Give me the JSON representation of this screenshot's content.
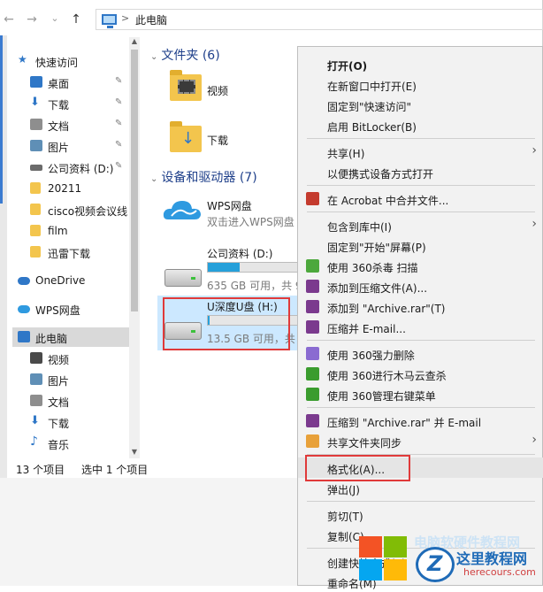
{
  "address_bar": {
    "back": "←",
    "forward": "→",
    "recent": "⌄",
    "up": "↑",
    "separator": ">",
    "path": "此电脑"
  },
  "nav": {
    "items": [
      {
        "label": "快速访问",
        "icon": "star-icon",
        "color": "#2f77c7",
        "pinned": false
      },
      {
        "label": "桌面",
        "icon": "desktop-icon",
        "color": "#2f77c7",
        "pinned": true
      },
      {
        "label": "下载",
        "icon": "download-icon",
        "color": "#2f77c7",
        "pinned": true
      },
      {
        "label": "文档",
        "icon": "document-icon",
        "color": "#8e8e8e",
        "pinned": true
      },
      {
        "label": "图片",
        "icon": "picture-icon",
        "color": "#5f8fb6",
        "pinned": true
      },
      {
        "label": "公司资料 (D:)",
        "icon": "drive-icon",
        "color": "#6b6b6b",
        "pinned": true
      },
      {
        "label": "20211",
        "icon": "folder-icon",
        "color": "#f3c54d",
        "pinned": false
      },
      {
        "label": "cisco视频会议线",
        "icon": "folder-icon",
        "color": "#f3c54d",
        "pinned": false
      },
      {
        "label": "film",
        "icon": "folder-icon",
        "color": "#f3c54d",
        "pinned": false
      },
      {
        "label": "迅雷下载",
        "icon": "folder-icon",
        "color": "#f3c54d",
        "pinned": false
      },
      {
        "label": "OneDrive",
        "icon": "onedrive-icon",
        "color": "#2f77c7",
        "pinned": false
      },
      {
        "label": "WPS网盘",
        "icon": "wps-cloud-icon",
        "color": "#2f9ae0",
        "pinned": false
      },
      {
        "label": "此电脑",
        "icon": "computer-icon",
        "color": "#2f77c7",
        "pinned": false,
        "selected": true
      },
      {
        "label": "视频",
        "icon": "video-icon",
        "color": "#4a4a4a",
        "pinned": false
      },
      {
        "label": "图片",
        "icon": "picture-icon",
        "color": "#5f8fb6",
        "pinned": false
      },
      {
        "label": "文档",
        "icon": "document-icon",
        "color": "#8e8e8e",
        "pinned": false
      },
      {
        "label": "下载",
        "icon": "download-icon",
        "color": "#2f77c7",
        "pinned": false
      },
      {
        "label": "音乐",
        "icon": "music-icon",
        "color": "#2f77c7",
        "pinned": false
      }
    ],
    "pin_glyph": "✎"
  },
  "content": {
    "folders_header": "文件夹 (6)",
    "folders": [
      {
        "label": "视频",
        "icon": "video-folder-icon"
      },
      {
        "label": "下载",
        "icon": "download-folder-icon"
      }
    ],
    "devices_header": "设备和驱动器 (7)",
    "wps": {
      "label": "WPS网盘",
      "sub": "双击进入WPS网盘"
    },
    "drive_d": {
      "label": "公司资料 (D:)",
      "sub": "635 GB 可用，共 9",
      "used_fraction": 0.35
    },
    "drive_h": {
      "label": "U深度U盘 (H:)",
      "sub": "13.5 GB 可用，共",
      "used_fraction": 0.02
    }
  },
  "status": {
    "count": "13 个项目",
    "selection": "选中 1 个项目"
  },
  "menu": {
    "items": [
      {
        "label": "打开(O)",
        "bold": true,
        "icon": null
      },
      {
        "label": "在新窗口中打开(E)",
        "icon": null
      },
      {
        "label": "固定到\"快速访问\"",
        "icon": null
      },
      {
        "label": "启用 BitLocker(B)",
        "icon": null
      },
      {
        "sep": true
      },
      {
        "label": "共享(H)",
        "icon": null,
        "submenu": true
      },
      {
        "label": "以便携式设备方式打开",
        "icon": null
      },
      {
        "sep": true
      },
      {
        "label": "在 Acrobat 中合并文件...",
        "icon": "acrobat-icon",
        "color": "#c43b2e"
      },
      {
        "sep": true
      },
      {
        "label": "包含到库中(I)",
        "icon": null,
        "submenu": true
      },
      {
        "label": "固定到\"开始\"屏幕(P)",
        "icon": null
      },
      {
        "label": "使用 360杀毒 扫描",
        "icon": "360-antivirus-icon",
        "color": "#4ca83c"
      },
      {
        "label": "添加到压缩文件(A)...",
        "icon": "winrar-icon",
        "color": "#7b3a8e"
      },
      {
        "label": "添加到 \"Archive.rar\"(T)",
        "icon": "winrar-icon",
        "color": "#7b3a8e"
      },
      {
        "label": "压缩并 E-mail...",
        "icon": "winrar-icon",
        "color": "#7b3a8e"
      },
      {
        "sep": true
      },
      {
        "label": "使用 360强力删除",
        "icon": "360-delete-icon",
        "color": "#8a6bd1"
      },
      {
        "label": "使用 360进行木马云查杀",
        "icon": "360-scan-icon",
        "color": "#3a9c2e"
      },
      {
        "label": "使用 360管理右键菜单",
        "icon": "360-menu-icon",
        "color": "#3a9c2e"
      },
      {
        "sep": true
      },
      {
        "label": "压缩到 \"Archive.rar\" 并 E-mail",
        "icon": "winrar-icon",
        "color": "#7b3a8e"
      },
      {
        "label": "共享文件夹同步",
        "icon": "sync-icon",
        "color": "#e8a13a",
        "submenu": true
      },
      {
        "sep": true
      },
      {
        "label": "格式化(A)...",
        "icon": null,
        "highlight": true
      },
      {
        "label": "弹出(J)",
        "icon": null
      },
      {
        "sep": true
      },
      {
        "label": "剪切(T)",
        "icon": null
      },
      {
        "label": "复制(C)",
        "icon": null
      },
      {
        "sep": true
      },
      {
        "label": "创建快捷方式(S)",
        "icon": null
      },
      {
        "label": "重命名(M)",
        "icon": null
      }
    ],
    "submenu_glyph": "›"
  },
  "watermark": {
    "faint_text": "电脑软硬件教程网",
    "logo_letter": "Z",
    "title": "这里教程网",
    "url": "herecours.com"
  }
}
